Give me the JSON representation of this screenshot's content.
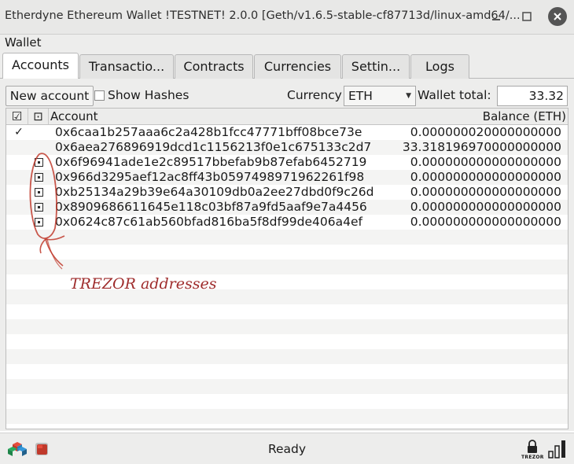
{
  "window": {
    "title": "Etherdyne Ethereum Wallet !TESTNET! 2.0.0 [Geth/v1.6.5-stable-cf87713d/linux-amd64/..."
  },
  "menu": {
    "wallet": "Wallet"
  },
  "tabs": [
    {
      "label": "Accounts",
      "active": true
    },
    {
      "label": "Transactio..."
    },
    {
      "label": "Contracts"
    },
    {
      "label": "Currencies"
    },
    {
      "label": "Settin..."
    },
    {
      "label": "Logs"
    }
  ],
  "toolbar": {
    "new_account": "New account",
    "show_hashes": "Show Hashes",
    "currency_label": "Currency",
    "currency_value": "ETH",
    "wallet_total_label": "Wallet total:",
    "wallet_total_value": "33.32"
  },
  "table": {
    "headers": {
      "col1": "☑",
      "col2": "⊡",
      "account": "Account",
      "balance": "Balance (ETH)"
    },
    "rows": [
      {
        "check": "✓",
        "hw": false,
        "address": "0x6caa1b257aaa6c2a428b1fcc47771bff08bce73e",
        "balance": "0.000000020000000000"
      },
      {
        "check": "",
        "hw": false,
        "address": "0x6aea276896919dcd1c1156213f0e1c675133c2d7",
        "balance": "33.318196970000000000"
      },
      {
        "check": "",
        "hw": true,
        "address": "0x6f96941ade1e2c89517bbefab9b87efab6452719",
        "balance": "0.000000000000000000"
      },
      {
        "check": "",
        "hw": true,
        "address": "0x966d3295aef12ac8ff43b0597498971962261f98",
        "balance": "0.000000000000000000"
      },
      {
        "check": "",
        "hw": true,
        "address": "0xb25134a29b39e64a30109db0a2ee27dbd0f9c26d",
        "balance": "0.000000000000000000"
      },
      {
        "check": "",
        "hw": true,
        "address": "0x8909686611645e118c03bf87a9fd5aaf9e7a4456",
        "balance": "0.000000000000000000"
      },
      {
        "check": "",
        "hw": true,
        "address": "0x0624c87c61ab560bfad816ba5f8df99de406a4ef",
        "balance": "0.000000000000000000"
      }
    ]
  },
  "annotation": {
    "text": "TREZOR addresses",
    "color": "#9e2b2b"
  },
  "status": {
    "text": "Ready",
    "trezor_label": "TREZOR",
    "icons": [
      "blocks-icon",
      "red-cube-icon",
      "trezor-lock-icon",
      "signal-bars-icon"
    ]
  }
}
